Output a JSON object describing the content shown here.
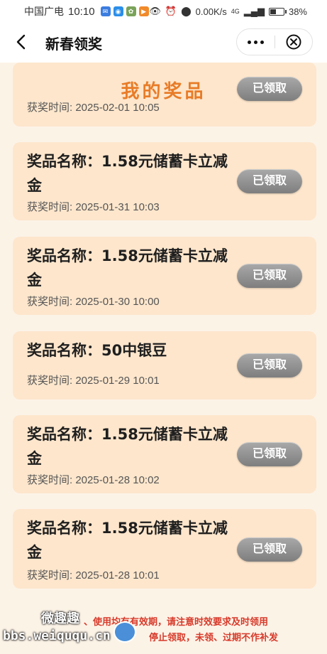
{
  "status_bar": {
    "carrier": "中国广电",
    "time": "10:10",
    "net_speed": "0.00K/s",
    "signal": "4G",
    "battery": "38%",
    "battery_level": 0.38
  },
  "nav": {
    "title": "新春领奖"
  },
  "page_title": "我的奖品",
  "prize_label": "奖品名称：",
  "time_label": "获奖时间: ",
  "prizes": [
    {
      "name": "",
      "time": "2025-02-01 10:05",
      "status": "已领取"
    },
    {
      "name": "1.58元储蓄卡立减金",
      "time": "2025-01-31 10:03",
      "status": "已领取"
    },
    {
      "name": "1.58元储蓄卡立减金",
      "time": "2025-01-30 10:00",
      "status": "已领取"
    },
    {
      "name": "50中银豆",
      "time": "2025-01-29 10:01",
      "status": "已领取"
    },
    {
      "name": "1.58元储蓄卡立减金",
      "time": "2025-01-28 10:02",
      "status": "已领取"
    },
    {
      "name": "1.58元储蓄卡立减金",
      "time": "2025-01-28 10:01",
      "status": "已领取"
    }
  ],
  "footer": {
    "line1": "、使用均有有效期，请注意时效要求及时领用",
    "line2": "停止领取，未领、过期不作补发"
  },
  "watermark": {
    "top": "微趣趣",
    "bottom": "bbs.weiququ.cn"
  },
  "colors": {
    "accent": "#e87c28",
    "card": "#fde6cc",
    "claimed_button": "#8f8f8f",
    "warning_text": "#d73a2a"
  }
}
